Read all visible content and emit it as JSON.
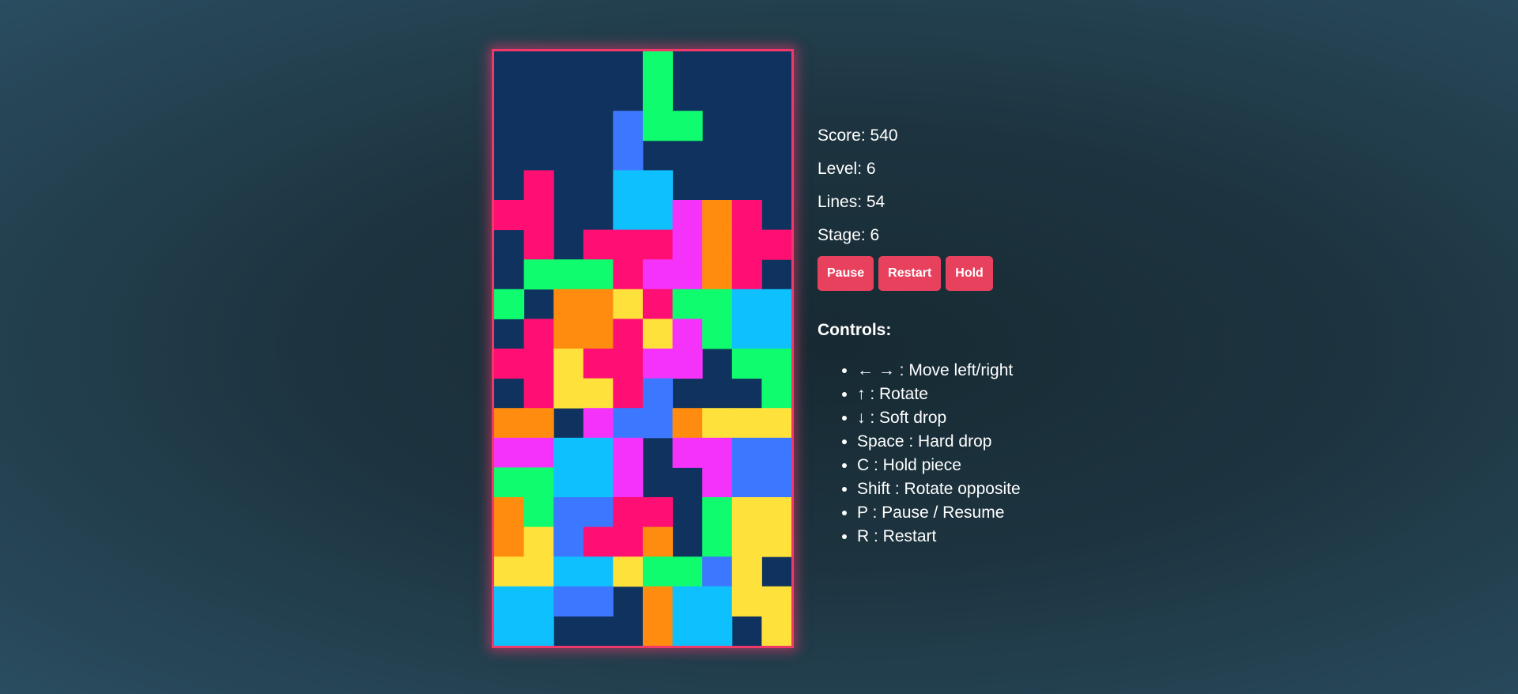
{
  "board": {
    "cols": 10,
    "rows": 20,
    "colors": {
      "empty": "#10325e",
      "G": "#0ffc6e",
      "B": "#3c78ff",
      "C": "#0fc0ff",
      "R": "#ff0f73",
      "M": "#f532fa",
      "O": "#ff8c0f",
      "Y": "#ffe13c",
      "border": "#f0396b"
    },
    "grid": [
      ".....G....",
      ".....G....",
      "....BGG...",
      "....B.....",
      ".R..CC....",
      "RR..CCMOR.",
      ".R.RRRMORR",
      ".GGGRMMOR.",
      "G.OOYRGGCC",
      ".ROORYMGCC",
      "RRYRRMM.GG",
      ".RYYRB...G",
      "OO.MBBOYYY",
      "MMCCM.MMBB",
      "GGCCM..MBB",
      "OGBBRR.GYY",
      "OYBRRO.GYY",
      "YYCCYGGBY.",
      "CCBB.OCCYY",
      "CC...OCC.Y"
    ]
  },
  "stats": {
    "score": "Score: 540",
    "level": "Level: 6",
    "lines": "Lines: 54",
    "stage": "Stage: 6"
  },
  "buttons": {
    "pause": "Pause",
    "restart": "Restart",
    "hold": "Hold"
  },
  "controls": {
    "title": "Controls:",
    "items": [
      "← → : Move left/right",
      "↑ : Rotate",
      "↓ : Soft drop",
      "Space : Hard drop",
      "C : Hold piece",
      "Shift : Rotate opposite",
      "P : Pause / Resume",
      "R : Restart"
    ]
  }
}
